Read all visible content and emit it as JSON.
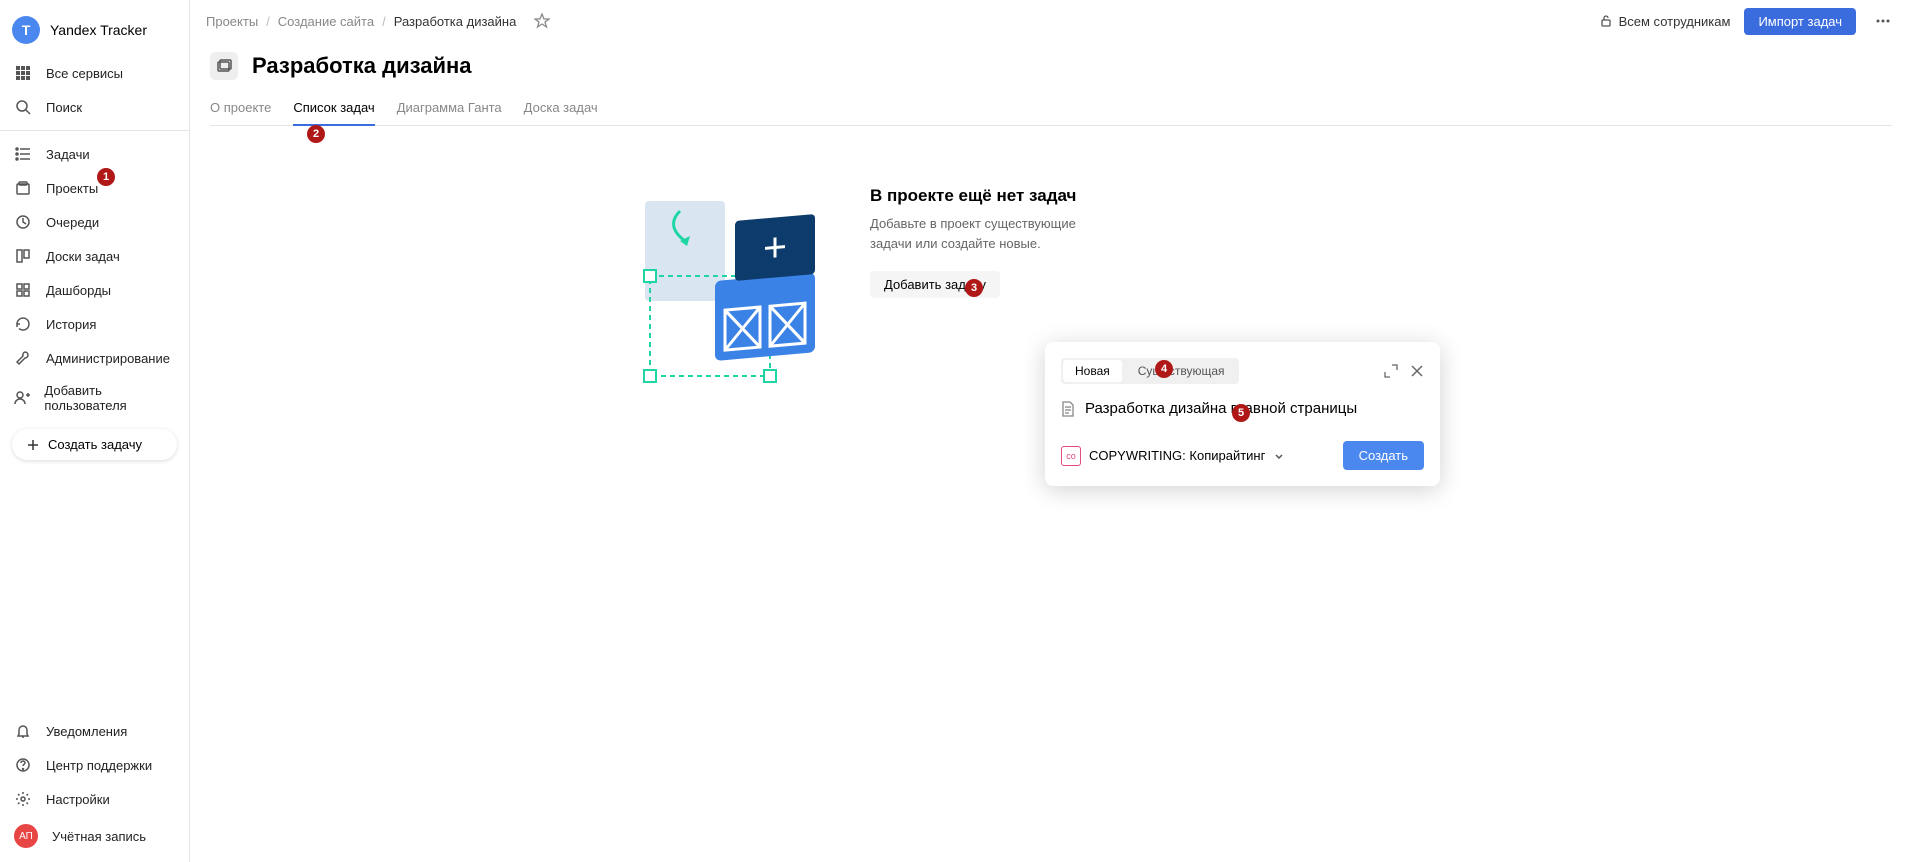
{
  "app": {
    "name": "Yandex Tracker",
    "logo_letter": "T"
  },
  "sidebar": {
    "all_services": "Все сервисы",
    "search": "Поиск",
    "tasks": "Задачи",
    "projects": "Проекты",
    "queues": "Очереди",
    "boards": "Доски задач",
    "dashboards": "Дашборды",
    "history": "История",
    "admin": "Администрирование",
    "add_user": "Добавить пользователя",
    "create_task": "Создать задачу",
    "notifications": "Уведомления",
    "support": "Центр поддержки",
    "settings": "Настройки",
    "account": "Учётная запись",
    "account_initials": "АП"
  },
  "breadcrumbs": {
    "items": [
      "Проекты",
      "Создание сайта",
      "Разработка дизайна"
    ]
  },
  "topbar": {
    "access": "Всем сотрудникам",
    "import": "Импорт задач"
  },
  "page": {
    "title": "Разработка дизайна"
  },
  "tabs": {
    "about": "О проекте",
    "list": "Список задач",
    "gantt": "Диаграмма Ганта",
    "board": "Доска задач"
  },
  "empty": {
    "title": "В проекте ещё нет задач",
    "desc": "Добавьте в проект существующие задачи или создайте новые.",
    "add": "Добавить задачу"
  },
  "panel": {
    "tab_new": "Новая",
    "tab_existing": "Существующая",
    "title_value": "Разработка дизайна главной страницы",
    "queue_code": "co",
    "queue_name": "COPYWRITING: Копирайтинг",
    "create": "Создать"
  },
  "annotations": [
    "1",
    "2",
    "3",
    "4",
    "5"
  ]
}
